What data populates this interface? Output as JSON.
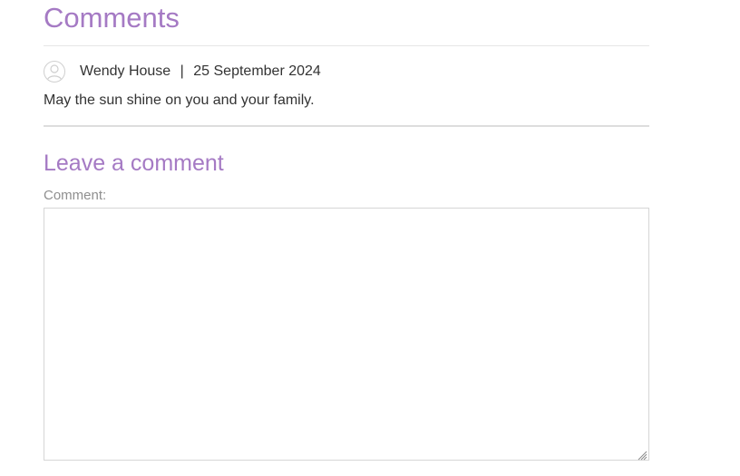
{
  "comments": {
    "title": "Comments",
    "items": [
      {
        "author": "Wendy House",
        "separator": "|",
        "date": "25 September 2024",
        "text": "May the sun shine on you and your family."
      }
    ]
  },
  "leave_comment": {
    "title": "Leave a comment",
    "field_label": "Comment:",
    "value": "",
    "placeholder": ""
  },
  "colors": {
    "heading": "#a57ac4",
    "text": "#333333",
    "label": "#8f8f8f",
    "border": "#d6d6d6"
  },
  "icons": {
    "avatar": "user-avatar-icon",
    "resize": "resize-grip-icon"
  }
}
